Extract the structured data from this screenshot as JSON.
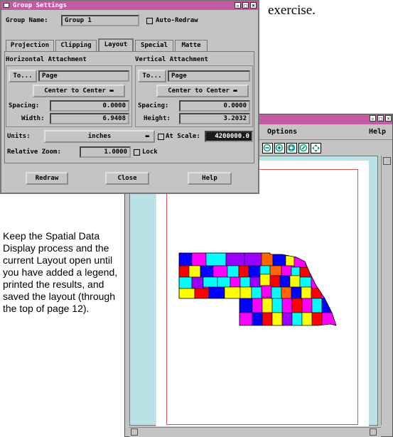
{
  "top_text": "exercise.",
  "side_text": "Keep the Spatial Data Display process and the current Layout open until you have added a legend, printed the results, and saved the layout (through the top of page 12).",
  "background_window": {
    "menu": [
      "Options",
      "Help"
    ]
  },
  "dialog": {
    "title": "Group Settings",
    "group_name_label": "Group Name:",
    "group_name_value": "Group 1",
    "auto_redraw_label": "Auto-Redraw",
    "tabs": [
      "Projection",
      "Clipping",
      "Layout",
      "Special",
      "Matte"
    ],
    "active_tab": "Layout",
    "horizontal": {
      "heading": "Horizontal Attachment",
      "to_button": "To...",
      "to_value": "Page",
      "mode": "Center to Center",
      "spacing_label": "Spacing:",
      "spacing_value": "0.0000",
      "size_label": "Width:",
      "size_value": "6.9408"
    },
    "vertical": {
      "heading": "Vertical Attachment",
      "to_button": "To...",
      "to_value": "Page",
      "mode": "Center to Center",
      "spacing_label": "Spacing:",
      "spacing_value": "0.0000",
      "size_label": "Height:",
      "size_value": "3.2032"
    },
    "units_label": "Units:",
    "units_value": "inches",
    "scale_label": "At Scale:",
    "scale_value": "4200000.0",
    "zoom_label": "Relative Zoom:",
    "zoom_value": "1.0000",
    "lock_label": "Lock",
    "buttons": {
      "redraw": "Redraw",
      "close": "Close",
      "help": "Help"
    }
  }
}
